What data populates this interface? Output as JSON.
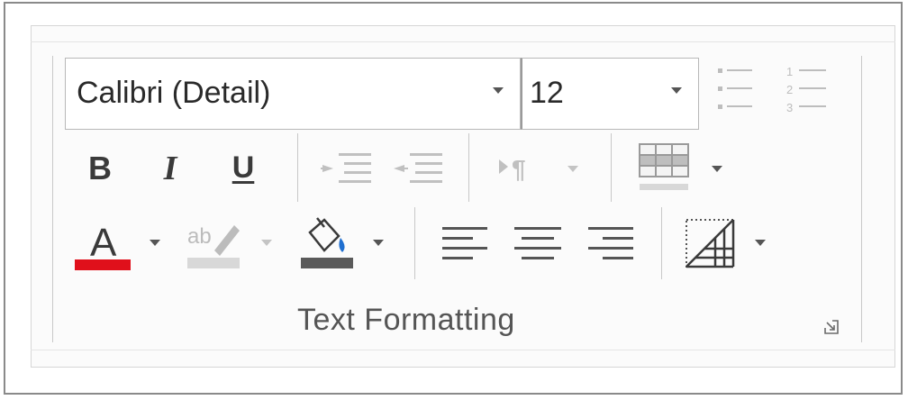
{
  "font_name": {
    "value": "Calibri (Detail)",
    "icon": "chevron-down-icon"
  },
  "font_size": {
    "value": "12",
    "icon": "chevron-down-icon"
  },
  "buttons": {
    "bold": "B",
    "italic": "I",
    "underline": "U",
    "font_color": "A",
    "strikethrough_icon": "ab"
  },
  "icons": {
    "bullets": "bulleted-list-icon",
    "numbering": "numbered-list-icon",
    "increase_indent": "increase-indent-icon",
    "decrease_indent": "decrease-indent-icon",
    "paragraph_direction": "paragraph-direction-icon",
    "table": "table-icon",
    "highlight": "text-highlight-icon",
    "fill": "paint-bucket-icon",
    "align_left": "align-left-icon",
    "align_center": "align-center-icon",
    "align_right": "align-right-icon",
    "borders": "borders-icon",
    "launcher": "dialog-launcher-icon"
  },
  "colors": {
    "font_color_bar": "#e0101b",
    "fill_color_bar": "#5a5a5a",
    "highlight_bar": "#d8d8d8",
    "enabled_glyph": "#3a3a3a",
    "disabled_glyph": "#b8b8b8"
  },
  "group": {
    "label": "Text Formatting"
  }
}
